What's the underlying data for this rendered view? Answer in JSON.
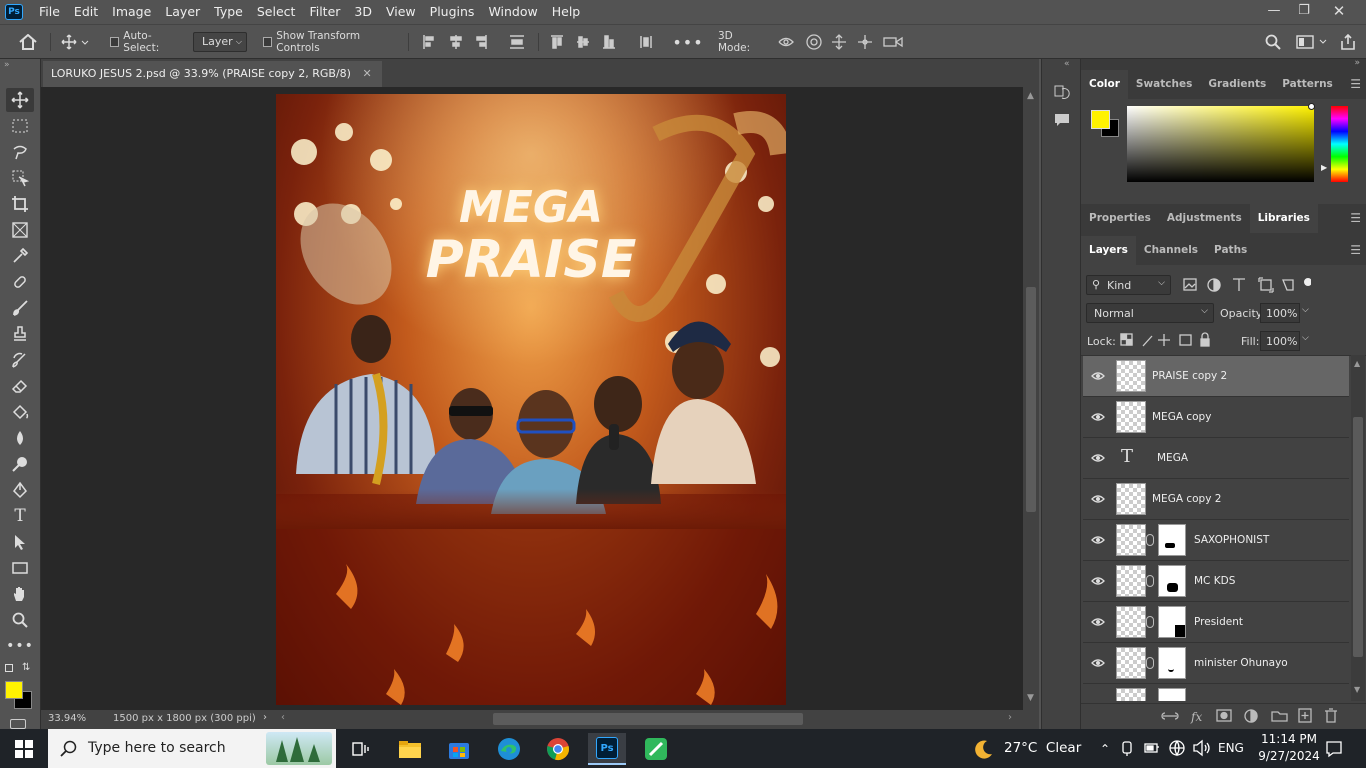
{
  "menubar": {
    "logo": "Ps",
    "items": [
      "File",
      "Edit",
      "Image",
      "Layer",
      "Type",
      "Select",
      "Filter",
      "3D",
      "View",
      "Plugins",
      "Window",
      "Help"
    ]
  },
  "options": {
    "auto_select_label": "Auto-Select:",
    "auto_select_value": "Layer",
    "show_transform_label": "Show Transform Controls",
    "mode_3d_label": "3D Mode:"
  },
  "document": {
    "tab_title": "LORUKO JESUS 2.psd @ 33.9% (PRAISE copy 2, RGB/8)",
    "poster_line1": "MEGA",
    "poster_line2": "PRAISE"
  },
  "status": {
    "zoom": "33.94%",
    "doc_info": "1500 px x 1800 px (300 ppi)"
  },
  "colors": {
    "foreground": "#fff200",
    "background": "#000000"
  },
  "color_panel": {
    "tabs": [
      "Color",
      "Swatches",
      "Gradients",
      "Patterns"
    ],
    "active": "Color"
  },
  "props_panel": {
    "tabs": [
      "Properties",
      "Adjustments",
      "Libraries"
    ],
    "active": "Libraries"
  },
  "layers_panel": {
    "tabs": [
      "Layers",
      "Channels",
      "Paths"
    ],
    "active": "Layers",
    "filter_kind": "Kind",
    "blend_mode": "Normal",
    "opacity_label": "Opacity:",
    "opacity_value": "100%",
    "lock_label": "Lock:",
    "fill_label": "Fill:",
    "fill_value": "100%",
    "layers": [
      {
        "name": "PRAISE copy 2",
        "type": "pixel",
        "selected": true
      },
      {
        "name": "MEGA copy",
        "type": "pixel",
        "selected": false
      },
      {
        "name": "MEGA",
        "type": "text",
        "selected": false
      },
      {
        "name": "MEGA copy 2",
        "type": "pixel",
        "selected": false
      },
      {
        "name": "SAXOPHONIST",
        "type": "masked",
        "selected": false
      },
      {
        "name": "MC KDS",
        "type": "masked",
        "selected": false
      },
      {
        "name": "President",
        "type": "masked",
        "selected": false
      },
      {
        "name": "minister Ohunayo",
        "type": "masked",
        "selected": false
      }
    ]
  },
  "taskbar": {
    "search_placeholder": "Type here to search",
    "weather": "27°C  Clear",
    "language": "ENG",
    "time": "11:14 PM",
    "date": "9/27/2024"
  }
}
